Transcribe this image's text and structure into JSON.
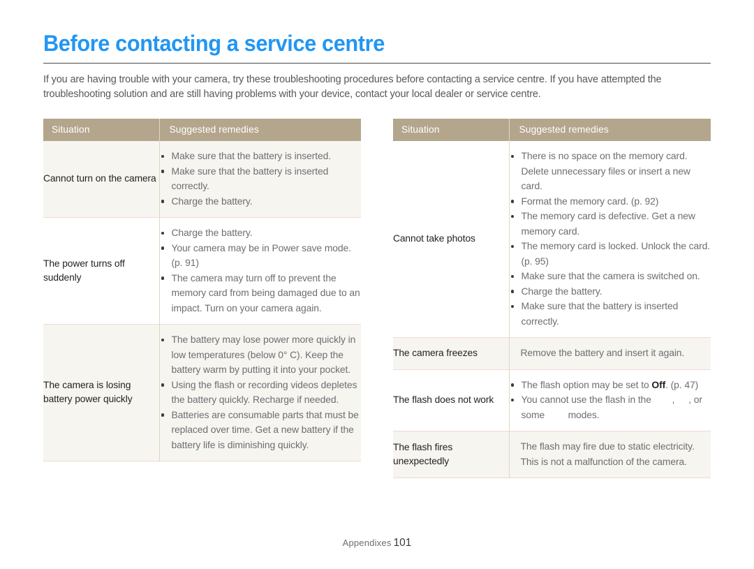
{
  "document": {
    "title": "Before contacting a service centre",
    "intro": "If you are having trouble with your camera, try these troubleshooting procedures before contacting a service centre. If you have attempted the troubleshooting solution and are still having problems with your device, contact your local dealer or service centre.",
    "footer_label": "Appendixes",
    "footer_page": "101"
  },
  "colors": {
    "title_blue": "#2196f3",
    "table_header_tan": "#b3a68c",
    "row_shade_cream": "#f7f5f0",
    "row_divider_pink": "#f0d8d5",
    "column_divider": "#ded6c0",
    "body_text_gray": "#6d6e71",
    "situation_text": "#231f20"
  },
  "tables": {
    "headers": {
      "situation": "Situation",
      "remedies": "Suggested remedies"
    },
    "left": {
      "rows": [
        {
          "situation": "Cannot turn on the camera",
          "shaded": true,
          "remedies": [
            "Make sure that the battery is inserted.",
            "Make sure that the battery is inserted correctly.",
            "Charge the battery."
          ]
        },
        {
          "situation": "The power turns off suddenly",
          "shaded": false,
          "remedies": [
            "Charge the battery.",
            "Your camera may be in Power save mode. (p. 91)",
            "The camera may turn off to prevent the memory card from being damaged due to an impact. Turn on your camera again."
          ]
        },
        {
          "situation": "The camera is losing battery power quickly",
          "shaded": true,
          "remedies": [
            "The battery may lose power more quickly in low temperatures (below 0° C). Keep the battery warm by putting it into your pocket.",
            "Using the flash or recording videos depletes the battery quickly. Recharge if needed.",
            "Batteries are consumable parts that must be replaced over time. Get a new battery if the battery life is diminishing quickly."
          ]
        }
      ]
    },
    "right": {
      "rows": [
        {
          "situation": "Cannot take photos",
          "shaded": false,
          "remedies": [
            "There is no space on the memory card. Delete unnecessary files or insert a new card.",
            "Format the memory card. (p. 92)",
            "The memory card is defective. Get a new memory card.",
            "The memory card is locked. Unlock the card. (p. 95)",
            "Make sure that the camera is switched on.",
            "Charge the battery.",
            "Make sure that the battery is inserted correctly."
          ]
        },
        {
          "situation": "The camera freezes",
          "shaded": true,
          "plain_text": "Remove the battery and insert it again."
        },
        {
          "situation": "The flash does not work",
          "shaded": false,
          "remedies_rich": [
            {
              "parts": [
                {
                  "type": "text",
                  "value": "The flash option may be set to "
                },
                {
                  "type": "bold",
                  "value": "Off"
                },
                {
                  "type": "text",
                  "value": ". (p. 47)"
                }
              ]
            },
            {
              "parts": [
                {
                  "type": "text",
                  "value": "You cannot use the flash in the "
                },
                {
                  "type": "icon-gap",
                  "value": "mode-icon-missing"
                },
                {
                  "type": "text",
                  "value": ", "
                },
                {
                  "type": "icon-gap-sm",
                  "value": "mode-icon-missing"
                },
                {
                  "type": "text",
                  "value": ", or some "
                },
                {
                  "type": "icon-gap",
                  "value": "mode-icon-missing"
                },
                {
                  "type": "text",
                  "value": " modes."
                }
              ]
            }
          ]
        },
        {
          "situation": "The flash fires unexpectedly",
          "shaded": true,
          "plain_text": "The flash may fire due to static electricity. This is not a malfunction of the camera."
        }
      ]
    }
  }
}
